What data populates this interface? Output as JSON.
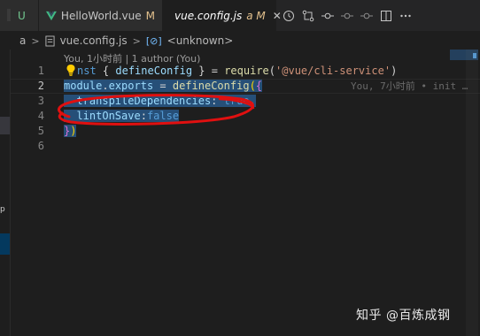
{
  "tabs": [
    {
      "label": "U",
      "modified": "",
      "italic": false,
      "icon": "none"
    },
    {
      "label": "HelloWorld.vue",
      "modified": "M",
      "italic": false,
      "icon": "vue-icon"
    },
    {
      "label": "vue.config.js",
      "modified": "a M",
      "italic": true,
      "icon": "config-file-icon",
      "active": true
    }
  ],
  "toolbar_icons": [
    "history-icon",
    "compare-changes-icon",
    "git-commit-icon",
    "previous-change-icon",
    "next-change-icon",
    "split-editor-icon",
    "more-icon"
  ],
  "breadcrumb": {
    "folder": "a",
    "file": "vue.config.js",
    "symbol": "<unknown>"
  },
  "codelens": "You, 1小时前 | 1 author (You)",
  "line_numbers": [
    "1",
    "2",
    "3",
    "4",
    "5",
    "6"
  ],
  "code": {
    "line1": {
      "kw": "nst",
      "open": " { ",
      "fn": "defineConfig",
      "close": " } = ",
      "req": "require",
      "po": "(",
      "str": "'@vue/cli-service'",
      "pc": ")"
    },
    "line2": {
      "mod": "module",
      "dot": ".",
      "exp": "exports",
      "eq": " = ",
      "fn": "defineConfig",
      "po": "(",
      "bo": "{",
      "blame": "You, 7小时前 • init …"
    },
    "line3": {
      "indent": "  ",
      "prop": "transpileDependencies",
      "colon": ": ",
      "val": "true",
      "comma": ","
    },
    "line4": {
      "indent": "  ",
      "prop": "lintOnSave",
      "colon": ":",
      "val": "false"
    },
    "line5": {
      "bc": "}",
      "pc": ")"
    }
  },
  "watermark": "知乎 @百炼成钢",
  "colors": {
    "annotation": "#e01010",
    "selection": "#264f78"
  }
}
